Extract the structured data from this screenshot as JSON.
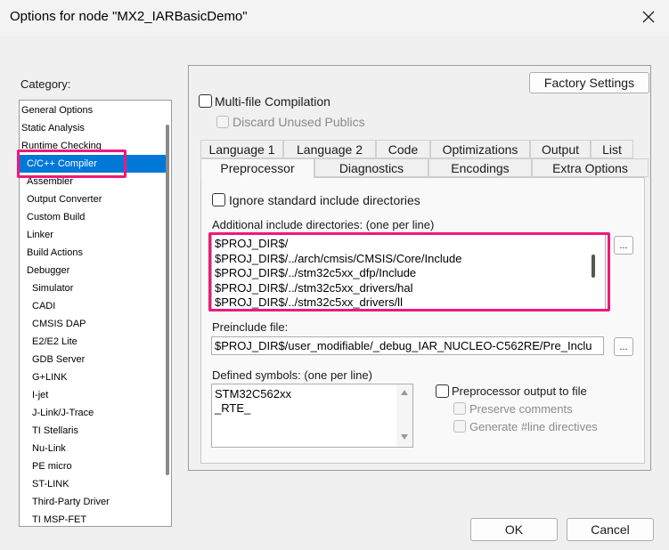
{
  "window": {
    "title": "Options for node \"MX2_IARBasicDemo\"",
    "close_icon": "close-icon"
  },
  "category": {
    "label": "Category:",
    "items": [
      "General Options",
      "Static Analysis",
      "Runtime Checking",
      "C/C++ Compiler",
      "Assembler",
      "Output Converter",
      "Custom Build",
      "Linker",
      "Build Actions",
      "Debugger",
      "Simulator",
      "CADI",
      "CMSIS DAP",
      "E2/E2 Lite",
      "GDB Server",
      "G+LINK",
      "I-jet",
      "J-Link/J-Trace",
      "TI Stellaris",
      "Nu-Link",
      "PE micro",
      "ST-LINK",
      "Third-Party Driver",
      "TI MSP-FET"
    ],
    "selected": "C/C++ Compiler"
  },
  "factory_settings_label": "Factory Settings",
  "multifile": {
    "label": "Multi-file Compilation",
    "checked": false
  },
  "discard": {
    "label": "Discard Unused Publics",
    "checked": false
  },
  "tabs_row1": [
    "Language 1",
    "Language 2",
    "Code",
    "Optimizations",
    "Output",
    "List"
  ],
  "tabs_row2": [
    "Preprocessor",
    "Diagnostics",
    "Encodings",
    "Extra Options"
  ],
  "active_tab": "Preprocessor",
  "preprocessor": {
    "ignore_std_label": "Ignore standard include directories",
    "include_dirs_label": "Additional include directories: (one per line)",
    "include_dirs": [
      "$PROJ_DIR$/",
      "$PROJ_DIR$/../arch/cmsis/CMSIS/Core/Include",
      "$PROJ_DIR$/../stm32c5xx_dfp/Include",
      "$PROJ_DIR$/../stm32c5xx_drivers/hal",
      "$PROJ_DIR$/../stm32c5xx_drivers/ll"
    ],
    "browse_label": "...",
    "preinclude_label": "Preinclude file:",
    "preinclude_value": "$PROJ_DIR$/user_modifiable/_debug_IAR_NUCLEO-C562RE/Pre_Inclu",
    "defined_symbols_label": "Defined symbols: (one per line)",
    "defined_symbols": [
      "STM32C562xx",
      "_RTE_"
    ],
    "pp_output_label": "Preprocessor output to file",
    "preserve_comments_label": "Preserve comments",
    "generate_line_label": "Generate #line directives"
  },
  "ok_label": "OK",
  "cancel_label": "Cancel",
  "colors": {
    "selection": "#0078d7",
    "highlight": "#f0187a"
  }
}
